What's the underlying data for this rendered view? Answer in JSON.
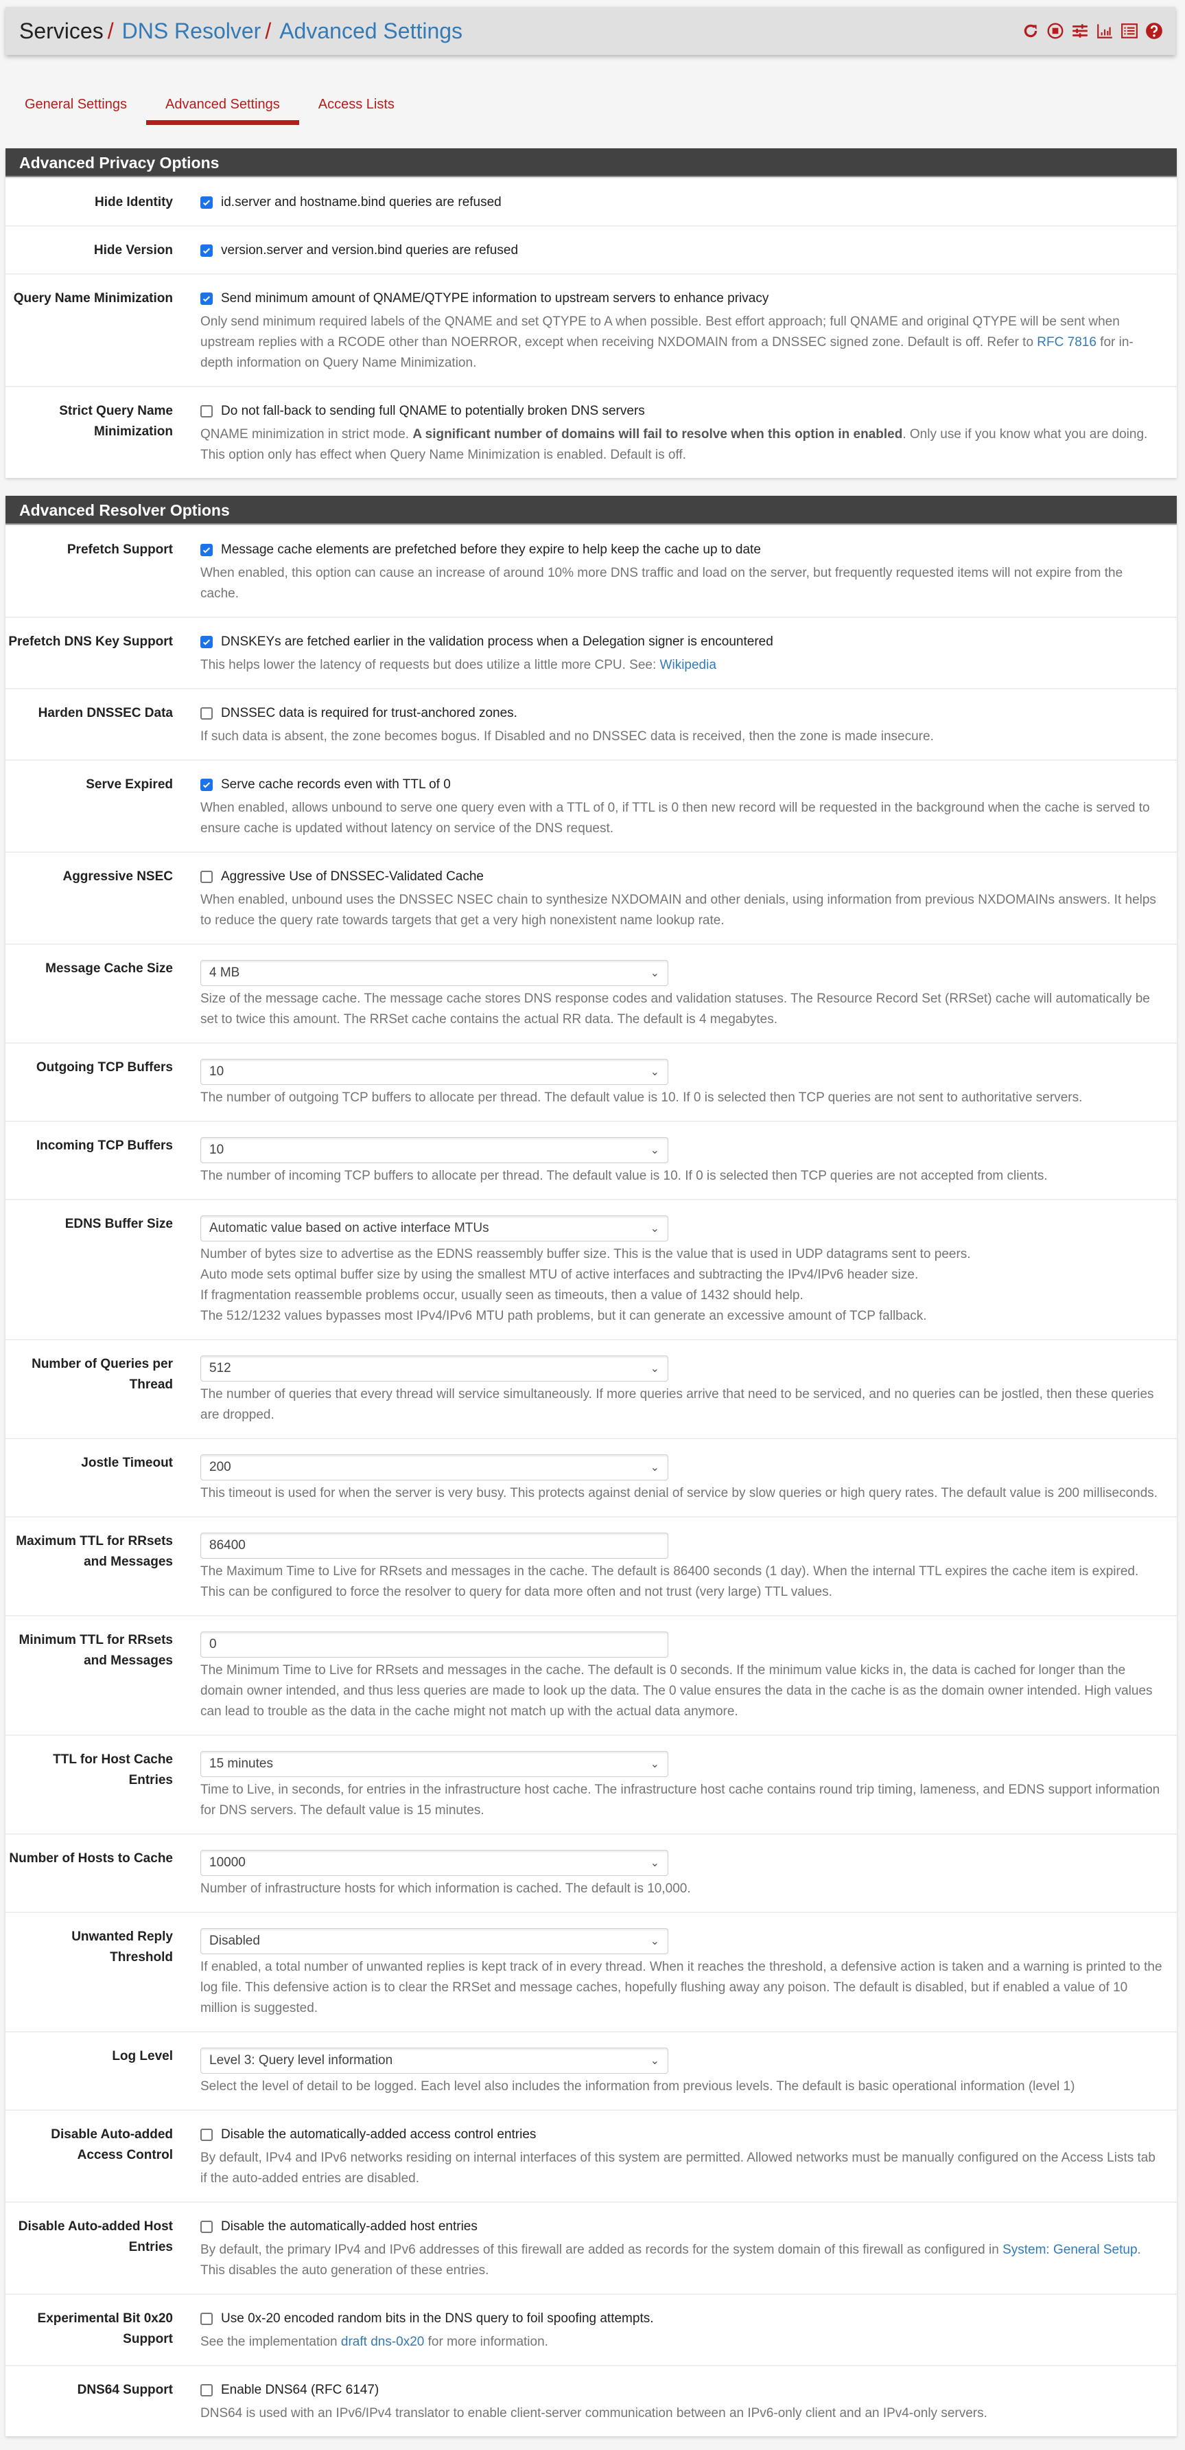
{
  "header": {
    "breadcrumb": [
      "Services",
      "DNS Resolver",
      "Advanced Settings"
    ],
    "separator": "/",
    "icons": [
      "reload-icon",
      "stop-icon",
      "sliders-icon",
      "chart-icon",
      "list-icon",
      "help-icon"
    ]
  },
  "tabs": [
    {
      "label": "General Settings",
      "active": false
    },
    {
      "label": "Advanced Settings",
      "active": true
    },
    {
      "label": "Access Lists",
      "active": false
    }
  ],
  "colors": {
    "accent": "#b71c1c",
    "link": "#337ab7",
    "panel_heading": "#424242",
    "checkbox": "#1a73e8"
  },
  "privacy": {
    "title": "Advanced Privacy Options",
    "rows": [
      {
        "label": "Hide Identity",
        "checked": true,
        "text": "id.server and hostname.bind queries are refused"
      },
      {
        "label": "Hide Version",
        "checked": true,
        "text": "version.server and version.bind queries are refused"
      },
      {
        "label": "Query Name Minimization",
        "checked": true,
        "text": "Send minimum amount of QNAME/QTYPE information to upstream servers to enhance privacy",
        "help_pre": "Only send minimum required labels of the QNAME and set QTYPE to A when possible. Best effort approach; full QNAME and original QTYPE will be sent when upstream replies with a RCODE other than NOERROR, except when receiving NXDOMAIN from a DNSSEC signed zone. Default is off. Refer to ",
        "help_link": "RFC 7816",
        "help_post": " for in-depth information on Query Name Minimization."
      },
      {
        "label": "Strict Query Name Minimization",
        "checked": false,
        "text": "Do not fall-back to sending full QNAME to potentially broken DNS servers",
        "help_pre": "QNAME minimization in strict mode. ",
        "help_bold": "A significant number of domains will fail to resolve when this option in enabled",
        "help_post": ". Only use if you know what you are doing. This option only has effect when Query Name Minimization is enabled. Default is off."
      }
    ]
  },
  "resolver": {
    "title": "Advanced Resolver Options",
    "prefetch": {
      "label": "Prefetch Support",
      "checked": true,
      "text": "Message cache elements are prefetched before they expire to help keep the cache up to date",
      "help": "When enabled, this option can cause an increase of around 10% more DNS traffic and load on the server, but frequently requested items will not expire from the cache."
    },
    "prefetch_key": {
      "label": "Prefetch DNS Key Support",
      "checked": true,
      "text": "DNSKEYs are fetched earlier in the validation process when a Delegation signer is encountered",
      "help_pre": "This helps lower the latency of requests but does utilize a little more CPU. See: ",
      "help_link": "Wikipedia"
    },
    "harden": {
      "label": "Harden DNSSEC Data",
      "checked": false,
      "text": "DNSSEC data is required for trust-anchored zones.",
      "help": "If such data is absent, the zone becomes bogus. If Disabled and no DNSSEC data is received, then the zone is made insecure."
    },
    "serve_expired": {
      "label": "Serve Expired",
      "checked": true,
      "text": "Serve cache records even with TTL of 0",
      "help": "When enabled, allows unbound to serve one query even with a TTL of 0, if TTL is 0 then new record will be requested in the background when the cache is served to ensure cache is updated without latency on service of the DNS request."
    },
    "aggressive_nsec": {
      "label": "Aggressive NSEC",
      "checked": false,
      "text": "Aggressive Use of DNSSEC-Validated Cache",
      "help": "When enabled, unbound uses the DNSSEC NSEC chain to synthesize NXDOMAIN and other denials, using information from previous NXDOMAINs answers. It helps to reduce the query rate towards targets that get a very high nonexistent name lookup rate."
    },
    "msg_cache": {
      "label": "Message Cache Size",
      "value": "4 MB",
      "help": "Size of the message cache. The message cache stores DNS response codes and validation statuses. The Resource Record Set (RRSet) cache will automatically be set to twice this amount. The RRSet cache contains the actual RR data. The default is 4 megabytes."
    },
    "out_tcp": {
      "label": "Outgoing TCP Buffers",
      "value": "10",
      "help": "The number of outgoing TCP buffers to allocate per thread. The default value is 10. If 0 is selected then TCP queries are not sent to authoritative servers."
    },
    "in_tcp": {
      "label": "Incoming TCP Buffers",
      "value": "10",
      "help": "The number of incoming TCP buffers to allocate per thread. The default value is 10. If 0 is selected then TCP queries are not accepted from clients."
    },
    "edns": {
      "label": "EDNS Buffer Size",
      "value": "Automatic value based on active interface MTUs",
      "help": [
        "Number of bytes size to advertise as the EDNS reassembly buffer size. This is the value that is used in UDP datagrams sent to peers.",
        "Auto mode sets optimal buffer size by using the smallest MTU of active interfaces and subtracting the IPv4/IPv6 header size.",
        "If fragmentation reassemble problems occur, usually seen as timeouts, then a value of 1432 should help.",
        "The 512/1232 values bypasses most IPv4/IPv6 MTU path problems, but it can generate an excessive amount of TCP fallback."
      ]
    },
    "queries": {
      "label": "Number of Queries per Thread",
      "value": "512",
      "help": "The number of queries that every thread will service simultaneously. If more queries arrive that need to be serviced, and no queries can be jostled, then these queries are dropped."
    },
    "jostle": {
      "label": "Jostle Timeout",
      "value": "200",
      "help": "This timeout is used for when the server is very busy. This protects against denial of service by slow queries or high query rates. The default value is 200 milliseconds."
    },
    "max_ttl": {
      "label": "Maximum TTL for RRsets and Messages",
      "value": "86400",
      "help": "The Maximum Time to Live for RRsets and messages in the cache. The default is 86400 seconds (1 day). When the internal TTL expires the cache item is expired. This can be configured to force the resolver to query for data more often and not trust (very large) TTL values."
    },
    "min_ttl": {
      "label": "Minimum TTL for RRsets and Messages",
      "value": "0",
      "help": "The Minimum Time to Live for RRsets and messages in the cache. The default is 0 seconds. If the minimum value kicks in, the data is cached for longer than the domain owner intended, and thus less queries are made to look up the data. The 0 value ensures the data in the cache is as the domain owner intended. High values can lead to trouble as the data in the cache might not match up with the actual data anymore."
    },
    "host_ttl": {
      "label": "TTL for Host Cache Entries",
      "value": "15 minutes",
      "help": "Time to Live, in seconds, for entries in the infrastructure host cache. The infrastructure host cache contains round trip timing, lameness, and EDNS support information for DNS servers. The default value is 15 minutes."
    },
    "num_hosts": {
      "label": "Number of Hosts to Cache",
      "value": "10000",
      "help": "Number of infrastructure hosts for which information is cached. The default is 10,000."
    },
    "unwanted": {
      "label": "Unwanted Reply Threshold",
      "value": "Disabled",
      "help": "If enabled, a total number of unwanted replies is kept track of in every thread. When it reaches the threshold, a defensive action is taken and a warning is printed to the log file. This defensive action is to clear the RRSet and message caches, hopefully flushing away any poison. The default is disabled, but if enabled a value of 10 million is suggested."
    },
    "log_level": {
      "label": "Log Level",
      "value": "Level 3: Query level information",
      "help": "Select the level of detail to be logged. Each level also includes the information from previous levels. The default is basic operational information (level 1)"
    },
    "disable_acl": {
      "label": "Disable Auto-added Access Control",
      "checked": false,
      "text": "Disable the automatically-added access control entries",
      "help": "By default, IPv4 and IPv6 networks residing on internal interfaces of this system are permitted. Allowed networks must be manually configured on the Access Lists tab if the auto-added entries are disabled."
    },
    "disable_host": {
      "label": "Disable Auto-added Host Entries",
      "checked": false,
      "text": "Disable the automatically-added host entries",
      "help_pre": "By default, the primary IPv4 and IPv6 addresses of this firewall are added as records for the system domain of this firewall as configured in ",
      "help_link": "System: General Setup",
      "help_post": ". This disables the auto generation of these entries."
    },
    "bit0x20": {
      "label": "Experimental Bit 0x20 Support",
      "checked": false,
      "text": "Use 0x-20 encoded random bits in the DNS query to foil spoofing attempts.",
      "help_pre": "See the implementation ",
      "help_link": "draft dns-0x20",
      "help_post": " for more information."
    },
    "dns64": {
      "label": "DNS64 Support",
      "checked": false,
      "text": "Enable DNS64 (RFC 6147)",
      "help": "DNS64 is used with an IPv6/IPv4 translator to enable client-server communication between an IPv6-only client and an IPv4-only servers."
    }
  }
}
